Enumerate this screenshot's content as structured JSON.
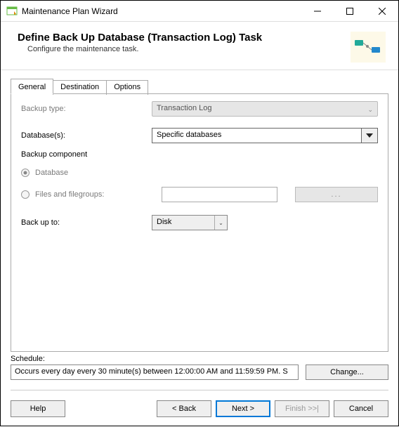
{
  "window": {
    "title": "Maintenance Plan Wizard"
  },
  "header": {
    "title": "Define Back Up Database (Transaction Log) Task",
    "subtitle": "Configure the maintenance task."
  },
  "tabs": {
    "general": "General",
    "destination": "Destination",
    "options": "Options"
  },
  "form": {
    "backup_type_label": "Backup type:",
    "backup_type_value": "Transaction Log",
    "databases_label": "Database(s):",
    "databases_value": "Specific databases",
    "backup_component_label": "Backup component",
    "radio_database": "Database",
    "radio_files": "Files and filegroups:",
    "ellipsis": "...",
    "backup_to_label": "Back up to:",
    "backup_to_value": "Disk"
  },
  "schedule": {
    "label": "Schedule:",
    "value": "Occurs every day every 30 minute(s) between 12:00:00 AM and 11:59:59 PM. S",
    "change_btn": "Change..."
  },
  "footer": {
    "help": "Help",
    "back": "< Back",
    "next": "Next >",
    "finish": "Finish >>|",
    "cancel": "Cancel"
  }
}
